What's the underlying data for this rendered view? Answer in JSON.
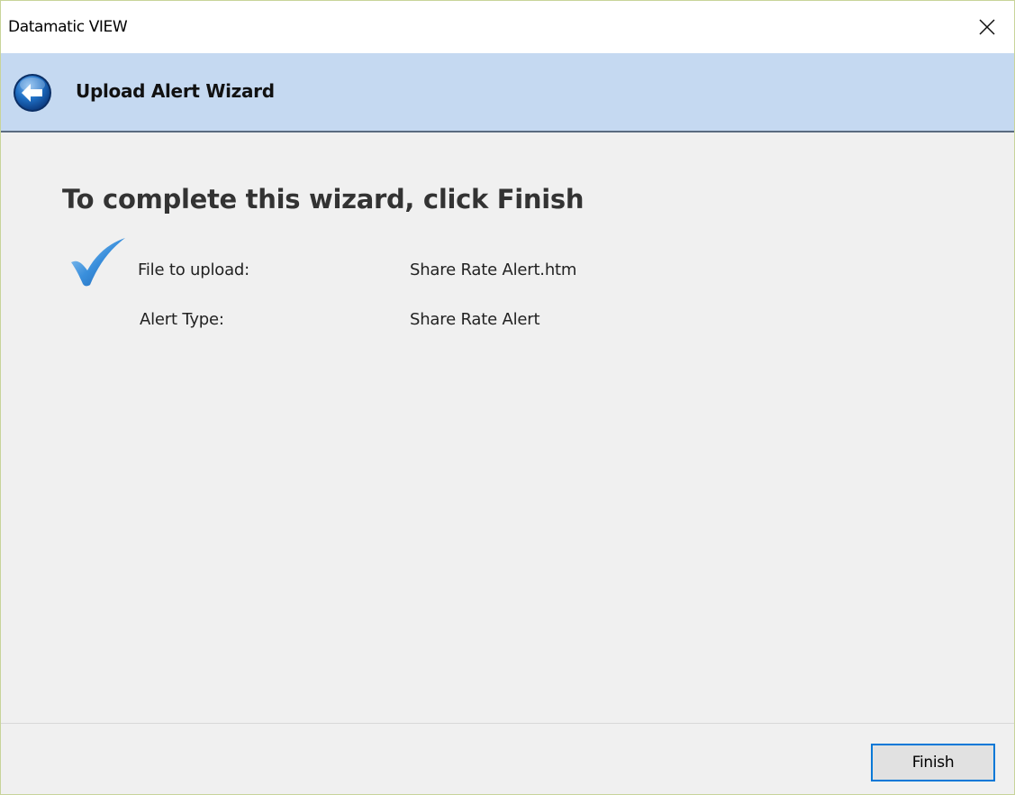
{
  "window": {
    "title": "Datamatic VIEW",
    "close_icon": "close-icon"
  },
  "header": {
    "back_icon": "back-arrow-icon",
    "title": "Upload Alert Wizard"
  },
  "main": {
    "heading": "To complete this wizard, click Finish",
    "status_icon": "checkmark-icon",
    "summary": [
      {
        "label": "File to upload:",
        "value": "Share Rate Alert.htm"
      },
      {
        "label": "Alert Type:",
        "value": "Share Rate Alert"
      }
    ]
  },
  "footer": {
    "finish_label": "Finish"
  },
  "colors": {
    "header_background": "#c5d9f1",
    "accent": "#0078d7",
    "heading_text": "#333333"
  }
}
